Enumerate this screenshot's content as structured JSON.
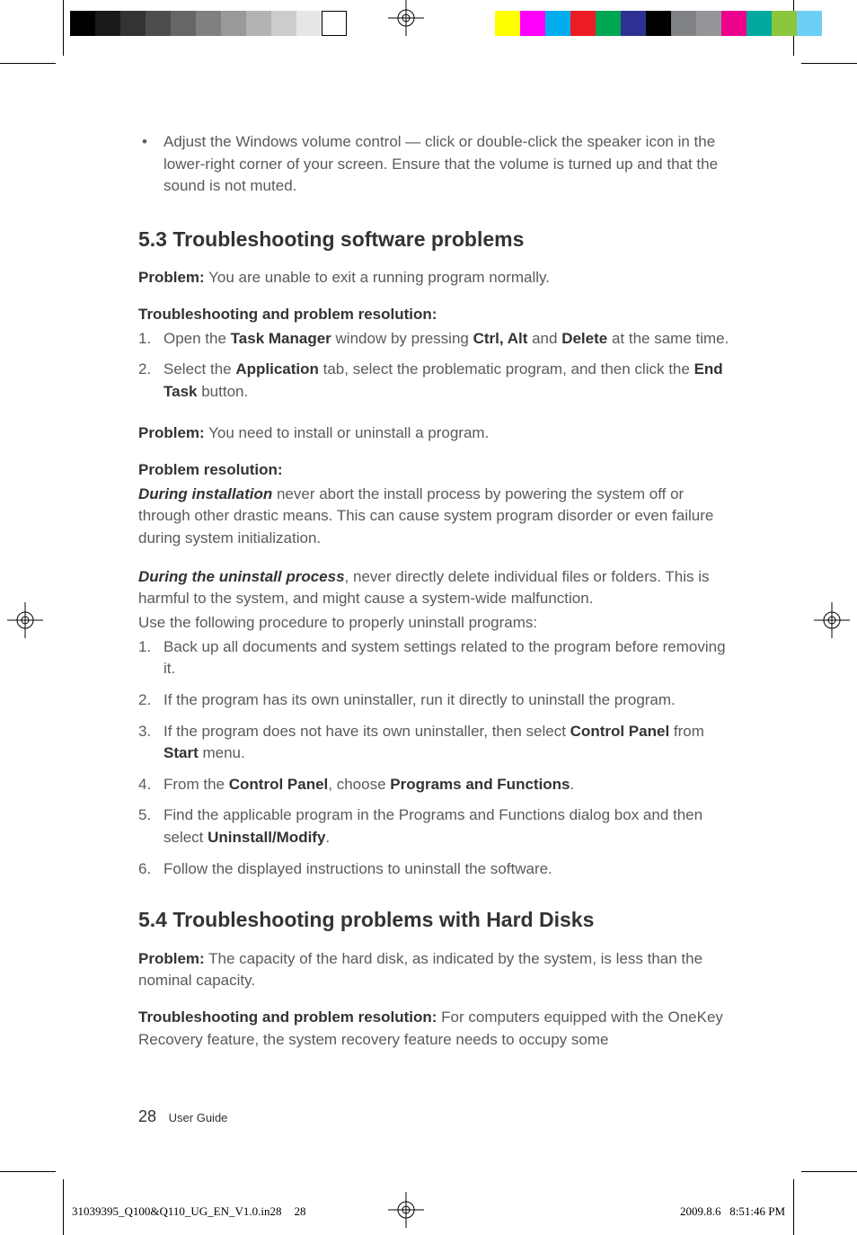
{
  "bullet_item": "Adjust the Windows volume control — click or double-click the speaker icon in the lower-right corner of your screen. Ensure that the volume is turned up and that the sound is not muted.",
  "section53": {
    "heading": "5.3 Troubleshooting software problems",
    "problem1_label": "Problem:",
    "problem1_text": " You are unable to exit a running program normally.",
    "trouble_label": "Troubleshooting and problem resolution:",
    "step1_pre": "Open the ",
    "step1_b1": "Task Manager",
    "step1_mid": " window by pressing ",
    "step1_b2": "Ctrl, Alt",
    "step1_mid2": " and ",
    "step1_b3": "Delete",
    "step1_post": " at the same time.",
    "step2_pre": "Select the ",
    "step2_b1": "Application",
    "step2_mid": " tab, select the problematic program, and then click the ",
    "step2_b2": "End Task",
    "step2_post": " button.",
    "problem2_label": "Problem:",
    "problem2_text": " You need to install or uninstall a program.",
    "res_label": "Problem resolution:",
    "install_em": "During installation",
    "install_text": " never abort the install process by powering the system off or through other drastic means. This can cause system program disorder or even failure during system initialization.",
    "uninstall_em": "During the uninstall process",
    "uninstall_text": ", never directly delete individual files or folders. This is harmful to the system, and might cause a system-wide malfunction.",
    "uninstall_intro": "Use the following procedure to properly uninstall programs:",
    "u1": "Back up all documents and system settings related to the program before removing it.",
    "u2": "If the program has its own uninstaller, run it directly to uninstall the program.",
    "u3_pre": "If the program does not have its own uninstaller, then select ",
    "u3_b1": "Control Panel",
    "u3_mid": " from ",
    "u3_b2": "Start",
    "u3_post": " menu.",
    "u4_pre": "From the ",
    "u4_b1": "Control Panel",
    "u4_mid": ", choose ",
    "u4_b2": "Programs and Functions",
    "u4_post": ".",
    "u5_pre": "Find the applicable program in the Programs and Functions dialog box and then select ",
    "u5_b1": "Uninstall/Modify",
    "u5_post": ".",
    "u6": "Follow the displayed instructions to uninstall the software."
  },
  "section54": {
    "heading": "5.4 Troubleshooting problems with Hard Disks",
    "problem_label": "Problem:",
    "problem_text": " The capacity of the hard disk, as indicated by the system, is less than the nominal capacity.",
    "trouble_label": "Troubleshooting and problem resolution:",
    "trouble_text": " For computers equipped with the OneKey Recovery feature, the system recovery feature needs to occupy some"
  },
  "footer": {
    "page_num": "28",
    "doc_title": "User Guide"
  },
  "slug": {
    "file": "31039395_Q100&Q110_UG_EN_V1.0.in28",
    "sig": "28",
    "date": "2009.8.6",
    "time": "8:51:46 PM"
  }
}
